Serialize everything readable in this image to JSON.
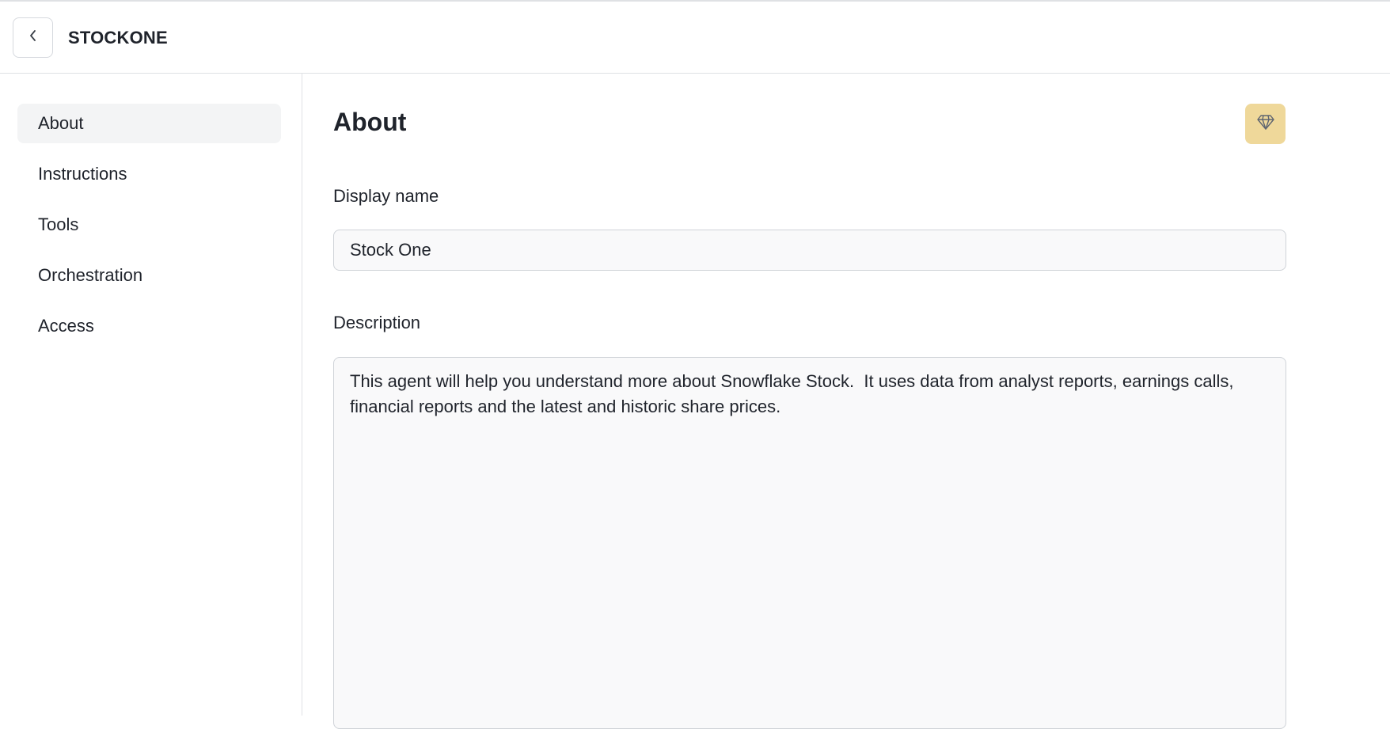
{
  "header": {
    "back_icon": "chevron-left-icon",
    "title": "STOCKONE"
  },
  "sidebar": {
    "items": [
      {
        "label": "About",
        "active": true
      },
      {
        "label": "Instructions",
        "active": false
      },
      {
        "label": "Tools",
        "active": false
      },
      {
        "label": "Orchestration",
        "active": false
      },
      {
        "label": "Access",
        "active": false
      }
    ]
  },
  "main": {
    "title": "About",
    "badge_icon": "gem-icon",
    "display_name": {
      "label": "Display name",
      "value": "Stock One"
    },
    "description": {
      "label": "Description",
      "value": "This agent will help you understand more about Snowflake Stock.  It uses data from analyst reports, earnings calls, financial reports and the latest and historic share prices."
    }
  },
  "colors": {
    "accent_badge": "#efd89a",
    "active_nav_bg": "#f3f4f5",
    "border": "#dfe1e4",
    "text": "#1f232b"
  }
}
